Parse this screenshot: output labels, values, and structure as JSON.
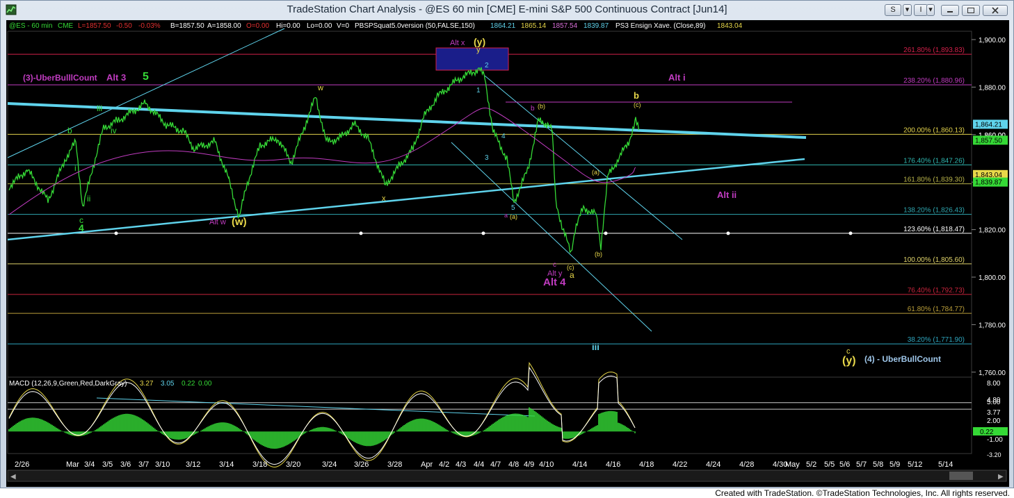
{
  "window": {
    "title": "TradeStation Chart Analysis - @ES 60 min [CME] E-mini S&P 500 Continuous Contract [Jun14]"
  },
  "info_line": {
    "symbol": "@ES - 60 min",
    "exchange": "CME",
    "last": "L=1857.50",
    "change": "-0.50",
    "change_pct": "-0.03%",
    "bid": "B=1857.50",
    "ask": "A=1858.00",
    "open": "O=0.00",
    "hi": "Hi=0.00",
    "lo": "Lo=0.00",
    "vol": "V=0",
    "study1": "PBSPSquat5.0version (50,FALSE,150)",
    "study1_vals": [
      "1864.21",
      "1865.14",
      "1857.54",
      "1839.87"
    ],
    "study2": "PS3 Ensign Xave. (Close,89)",
    "study2_val": "1843.04"
  },
  "macd_line": {
    "label": "MACD (12,26,9,Green,Red,DarkGray)",
    "values": [
      "3.27",
      "3.05",
      "0.22",
      "0.00"
    ]
  },
  "price_axis": {
    "ticks": [
      "1,900.00",
      "1,880.00",
      "1,860.00",
      "1,840.00",
      "1,820.00",
      "1,800.00",
      "1,780.00",
      "1,760.00"
    ],
    "last_price": "1,857.50",
    "tag1": "1,864.21",
    "tag2": "1,843.04",
    "tag3": "1,839.87",
    "tag_1860": "1,860.00"
  },
  "macd_axis": {
    "ticks": [
      "8.00",
      "5.00",
      "2.00",
      "-1.00"
    ],
    "upper": "4.80",
    "lower": "3.77",
    "zero_val": "0.22",
    "bottom": "-3.20"
  },
  "date_axis": [
    "2/26",
    "Mar",
    "3/4",
    "3/5",
    "3/6",
    "3/7",
    "3/10",
    "3/12",
    "3/14",
    "3/18",
    "3/20",
    "3/24",
    "3/26",
    "3/28",
    "Apr",
    "4/2",
    "4/3",
    "4/4",
    "4/7",
    "4/8",
    "4/9",
    "4/10",
    "4/14",
    "4/16",
    "4/18",
    "4/22",
    "4/24",
    "4/28",
    "4/30",
    "May",
    "5/2",
    "5/5",
    "5/6",
    "5/7",
    "5/8",
    "5/9",
    "5/12",
    "5/14"
  ],
  "fib_levels": [
    {
      "label": "261.80% (1,893.83)",
      "color": "#d4204a"
    },
    {
      "label": "238.20% (1,880.96)",
      "color": "#c13cc1"
    },
    {
      "label": "200.00% (1,860.13)",
      "color": "#e3d24c"
    },
    {
      "label": "176.40% (1,847.26)",
      "color": "#2fb7b0"
    },
    {
      "label": "161.80% (1,839.30)",
      "color": "#b9b44a"
    },
    {
      "label": "138.20% (1,826.43)",
      "color": "#2fa7b0"
    },
    {
      "label": "123.60% (1,818.47)",
      "color": "#ffffff"
    },
    {
      "label": "100.00% (1,805.60)",
      "color": "#e0d36a"
    },
    {
      "label": "76.40% (1,792.73)",
      "color": "#c8243c"
    },
    {
      "label": "61.80% (1,784.77)",
      "color": "#bb9f3a"
    },
    {
      "label": "38.20% (1,771.90)",
      "color": "#2fa7c0"
    }
  ],
  "annotations": {
    "uber_count": "(3)-UberBulllCount",
    "alt3": "Alt 3",
    "five": "5",
    "iii_small": "iii",
    "iv": "iv",
    "b": "b",
    "i": "i",
    "ii": "ii",
    "c_green": "c",
    "four_green": "4",
    "w": "w",
    "alt_w": "Alt w",
    "w_paren": "(w)",
    "x": "x",
    "alt_x": "Alt x",
    "y_paren": "(y)",
    "y_small": "y",
    "one": "1",
    "two": "2",
    "three": "3",
    "four": "4",
    "five_blue": "5",
    "a_mag": "a",
    "a_paren1": "(a)",
    "b_mag": "b",
    "b_paren1": "(b)",
    "c_mag": "c",
    "alt_y": "Alt y",
    "alt4": "Alt 4",
    "c_paren": "(c)",
    "a_yellow": "a",
    "a_paren2": "(a)",
    "b_paren2": "(b)",
    "b_yellow": "b",
    "c_paren_yellow": "(c)",
    "alt_i": "Alt i",
    "alt_ii": "Alt ii",
    "iii_big": "iii",
    "c_yellow": "c",
    "y_paren_yellow": "(y)",
    "uber4": "(4) - UberBullCount"
  },
  "footer": "Created with TradeStation. ©TradeStation Technologies, Inc. All rights reserved.",
  "colors": {
    "price": "#35d936",
    "background": "#000000",
    "trendline": "#5fd3ec",
    "magenta": "#c13cc1",
    "yellow": "#e8d84a"
  }
}
